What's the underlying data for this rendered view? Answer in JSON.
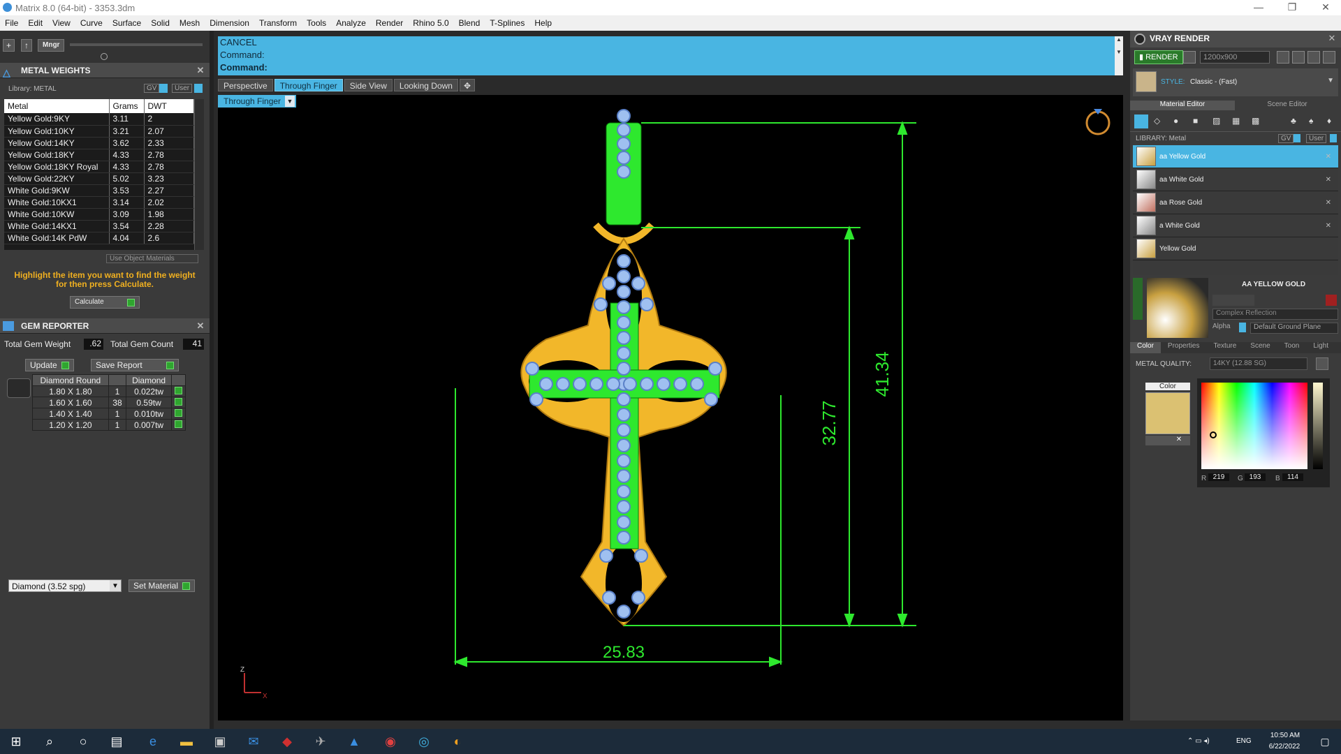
{
  "window": {
    "title": "Matrix 8.0 (64-bit) - 3353.3dm"
  },
  "menu": [
    "File",
    "Edit",
    "View",
    "Curve",
    "Surface",
    "Solid",
    "Mesh",
    "Dimension",
    "Transform",
    "Tools",
    "Analyze",
    "Render",
    "Rhino 5.0",
    "Blend",
    "T-Splines",
    "Help"
  ],
  "left_toolbar": {
    "mngr": "Mngr"
  },
  "metal_weights": {
    "title": "METAL WEIGHTS",
    "library_label": "Library: METAL",
    "gv_label": "GV",
    "user_label": "User",
    "columns": [
      "Metal",
      "Grams",
      "DWT"
    ],
    "rows": [
      [
        "Yellow Gold:9KY",
        "3.11",
        "2"
      ],
      [
        "Yellow Gold:10KY",
        "3.21",
        "2.07"
      ],
      [
        "Yellow Gold:14KY",
        "3.62",
        "2.33"
      ],
      [
        "Yellow Gold:18KY",
        "4.33",
        "2.78"
      ],
      [
        "Yellow Gold:18KY Royal",
        "4.33",
        "2.78"
      ],
      [
        "Yellow Gold:22KY",
        "5.02",
        "3.23"
      ],
      [
        "White Gold:9KW",
        "3.53",
        "2.27"
      ],
      [
        "White Gold:10KX1",
        "3.14",
        "2.02"
      ],
      [
        "White Gold:10KW",
        "3.09",
        "1.98"
      ],
      [
        "White Gold:14KX1",
        "3.54",
        "2.28"
      ],
      [
        "White Gold:14K PdW",
        "4.04",
        "2.6"
      ]
    ],
    "use_object_materials": "Use Object Materials",
    "hint": "Highlight the item you want to find the weight for then press Calculate.",
    "calculate": "Calculate"
  },
  "gem_reporter": {
    "title": "GEM REPORTER",
    "total_weight_label": "Total Gem Weight",
    "total_weight": ".62",
    "total_count_label": "Total Gem Count",
    "total_count": "41",
    "update": "Update",
    "save_report": "Save Report",
    "columns": [
      "Diamond Round",
      "",
      "Diamond"
    ],
    "rows": [
      [
        "1.80 X 1.80",
        "1",
        "0.022tw"
      ],
      [
        "1.60 X 1.60",
        "38",
        "0.59tw"
      ],
      [
        "1.40 X 1.40",
        "1",
        "0.010tw"
      ],
      [
        "1.20 X 1.20",
        "1",
        "0.007tw"
      ]
    ],
    "material_select": "Diamond    (3.52 spg)",
    "set_material": "Set Material"
  },
  "command": {
    "line1": "CANCEL",
    "line2": "Command:",
    "line3": "Command:"
  },
  "view_tabs": [
    "Perspective",
    "Through Finger",
    "Side View",
    "Looking Down"
  ],
  "active_view": "Through Finger",
  "viewport_label": "Through Finger",
  "dimensions": {
    "height_total": "41.34",
    "height_inner": "32.77",
    "width": "25.83"
  },
  "axis": {
    "z": "Z",
    "x": "X"
  },
  "vray": {
    "title": "VRAY RENDER",
    "render": "RENDER",
    "resolution": "1200x900",
    "style_label": "STYLE:",
    "style_value": "Classic - (Fast)",
    "tabs": [
      "Material Editor",
      "Scene Editor"
    ],
    "library_label": "LIBRARY: Metal",
    "gv_label": "GV",
    "user_label": "User",
    "materials": [
      "aa Yellow Gold",
      "aa White Gold",
      "aa Rose Gold",
      "a White Gold",
      "Yellow Gold"
    ],
    "selected_material": "AA YELLOW GOLD",
    "reflection": "Complex Reflection",
    "alpha": "Alpha",
    "ground_plane": "Default Ground Plane",
    "prop_tabs": [
      "Color",
      "Properties",
      "Texture",
      "Scene",
      "Toon",
      "Light"
    ],
    "metal_quality_label": "METAL QUALITY:",
    "metal_quality": "14KY        (12.88 SG)",
    "color_label": "Color",
    "r": "219",
    "g": "193",
    "b": "114",
    "r_label": "R",
    "g_label": "G",
    "b_label": "B",
    "swatch": "#dbc172"
  },
  "taskbar": {
    "time": "10:50 AM",
    "date": "6/22/2022",
    "lang": "ENG"
  }
}
